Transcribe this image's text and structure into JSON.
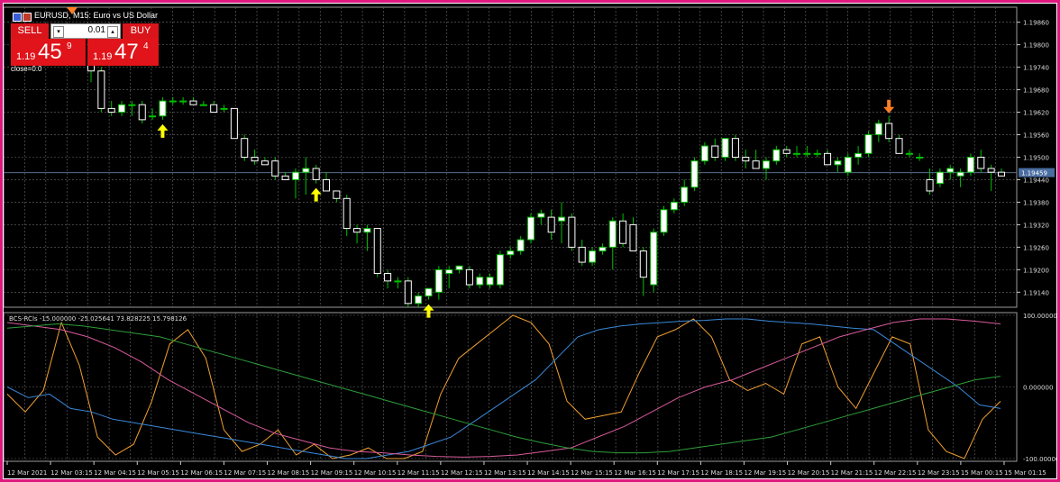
{
  "window": {
    "symbol_line": "EURUSD, M15:  Euro vs US Dollar",
    "close_label": "close=0.0"
  },
  "trade_panel": {
    "sell_label": "SELL",
    "buy_label": "BUY",
    "lot_value": "0.01",
    "sell_big_prefix": "1.19",
    "sell_big_digits": "45",
    "sell_sup": "9",
    "buy_big_prefix": "1.19",
    "buy_big_digits": "47",
    "buy_sup": "4"
  },
  "colors": {
    "background": "#000000",
    "grid": "#6b6b6b",
    "candle_bull": "#ffffff",
    "candle_bear": "#ffffff",
    "wick": "#00c000",
    "arrow_up": "#ffff00",
    "arrow_down": "#ff7f27",
    "rci_short": "#f0a030",
    "rci_mid": "#3a88d8",
    "rci_long": "#d85a9a",
    "rci_green": "#2e9e3a"
  },
  "chart_data": [
    {
      "type": "candlestick",
      "y_ticks": [
        "1.19860",
        "1.19800",
        "1.19740",
        "1.19680",
        "1.19620",
        "1.19560",
        "1.19500",
        "1.19440",
        "1.19380",
        "1.19320",
        "1.19260",
        "1.19200",
        "1.19140"
      ],
      "ylim": [
        1.191,
        1.199
      ],
      "current_price_label": "1.19459",
      "current_price": 1.19459,
      "candles": [
        {
          "o": 1.1977,
          "h": 1.198,
          "l": 1.197,
          "c": 1.1973
        },
        {
          "o": 1.1973,
          "h": 1.1974,
          "l": 1.1962,
          "c": 1.1963
        },
        {
          "o": 1.1963,
          "h": 1.1965,
          "l": 1.1961,
          "c": 1.1962
        },
        {
          "o": 1.1962,
          "h": 1.1965,
          "l": 1.1961,
          "c": 1.1964
        },
        {
          "o": 1.1964,
          "h": 1.1965,
          "l": 1.1961,
          "c": 1.1964
        },
        {
          "o": 1.1964,
          "h": 1.1965,
          "l": 1.1959,
          "c": 1.196
        },
        {
          "o": 1.1961,
          "h": 1.1963,
          "l": 1.196,
          "c": 1.1961
        },
        {
          "o": 1.1961,
          "h": 1.1966,
          "l": 1.196,
          "c": 1.1965
        },
        {
          "o": 1.1965,
          "h": 1.1966,
          "l": 1.1964,
          "c": 1.1965
        },
        {
          "o": 1.1965,
          "h": 1.1966,
          "l": 1.1964,
          "c": 1.1965
        },
        {
          "o": 1.1965,
          "h": 1.1966,
          "l": 1.1964,
          "c": 1.1964
        },
        {
          "o": 1.1964,
          "h": 1.1965,
          "l": 1.1964,
          "c": 1.1964
        },
        {
          "o": 1.1964,
          "h": 1.1965,
          "l": 1.1962,
          "c": 1.1962
        },
        {
          "o": 1.1963,
          "h": 1.1964,
          "l": 1.1962,
          "c": 1.1963
        },
        {
          "o": 1.1963,
          "h": 1.1963,
          "l": 1.1955,
          "c": 1.1955
        },
        {
          "o": 1.1955,
          "h": 1.1956,
          "l": 1.1949,
          "c": 1.195
        },
        {
          "o": 1.195,
          "h": 1.1952,
          "l": 1.1948,
          "c": 1.1949
        },
        {
          "o": 1.1949,
          "h": 1.195,
          "l": 1.1948,
          "c": 1.1948
        },
        {
          "o": 1.1949,
          "h": 1.195,
          "l": 1.1944,
          "c": 1.1945
        },
        {
          "o": 1.1945,
          "h": 1.1946,
          "l": 1.1944,
          "c": 1.1944
        },
        {
          "o": 1.1944,
          "h": 1.1947,
          "l": 1.1939,
          "c": 1.1946
        },
        {
          "o": 1.1946,
          "h": 1.195,
          "l": 1.194,
          "c": 1.1947
        },
        {
          "o": 1.1947,
          "h": 1.1948,
          "l": 1.1943,
          "c": 1.1944
        },
        {
          "o": 1.1944,
          "h": 1.1946,
          "l": 1.1941,
          "c": 1.1941
        },
        {
          "o": 1.1941,
          "h": 1.1941,
          "l": 1.1938,
          "c": 1.1939
        },
        {
          "o": 1.1939,
          "h": 1.194,
          "l": 1.1929,
          "c": 1.1931
        },
        {
          "o": 1.1931,
          "h": 1.1932,
          "l": 1.1927,
          "c": 1.193
        },
        {
          "o": 1.193,
          "h": 1.1932,
          "l": 1.1925,
          "c": 1.1931
        },
        {
          "o": 1.1931,
          "h": 1.1931,
          "l": 1.1918,
          "c": 1.1919
        },
        {
          "o": 1.1919,
          "h": 1.192,
          "l": 1.1915,
          "c": 1.1917
        },
        {
          "o": 1.1917,
          "h": 1.1918,
          "l": 1.1915,
          "c": 1.1917
        },
        {
          "o": 1.1917,
          "h": 1.1918,
          "l": 1.191,
          "c": 1.1911
        },
        {
          "o": 1.1911,
          "h": 1.1914,
          "l": 1.191,
          "c": 1.1913
        },
        {
          "o": 1.1913,
          "h": 1.1915,
          "l": 1.1912,
          "c": 1.1915
        },
        {
          "o": 1.1914,
          "h": 1.1921,
          "l": 1.1912,
          "c": 1.192
        },
        {
          "o": 1.1919,
          "h": 1.1921,
          "l": 1.1915,
          "c": 1.192
        },
        {
          "o": 1.192,
          "h": 1.1921,
          "l": 1.1919,
          "c": 1.1921
        },
        {
          "o": 1.192,
          "h": 1.1921,
          "l": 1.1915,
          "c": 1.1916
        },
        {
          "o": 1.1916,
          "h": 1.1919,
          "l": 1.1915,
          "c": 1.1918
        },
        {
          "o": 1.1916,
          "h": 1.1919,
          "l": 1.1915,
          "c": 1.1918
        },
        {
          "o": 1.1916,
          "h": 1.1925,
          "l": 1.1915,
          "c": 1.1924
        },
        {
          "o": 1.1924,
          "h": 1.1926,
          "l": 1.1923,
          "c": 1.1925
        },
        {
          "o": 1.1925,
          "h": 1.1929,
          "l": 1.1924,
          "c": 1.1928
        },
        {
          "o": 1.1928,
          "h": 1.1935,
          "l": 1.1927,
          "c": 1.1934
        },
        {
          "o": 1.1934,
          "h": 1.1936,
          "l": 1.1932,
          "c": 1.1935
        },
        {
          "o": 1.1934,
          "h": 1.1936,
          "l": 1.1928,
          "c": 1.193
        },
        {
          "o": 1.1933,
          "h": 1.1938,
          "l": 1.1927,
          "c": 1.1934
        },
        {
          "o": 1.1934,
          "h": 1.1935,
          "l": 1.1925,
          "c": 1.1926
        },
        {
          "o": 1.1926,
          "h": 1.1928,
          "l": 1.1921,
          "c": 1.1922
        },
        {
          "o": 1.1922,
          "h": 1.1926,
          "l": 1.1921,
          "c": 1.1925
        },
        {
          "o": 1.1925,
          "h": 1.1927,
          "l": 1.1924,
          "c": 1.1926
        },
        {
          "o": 1.1926,
          "h": 1.1934,
          "l": 1.192,
          "c": 1.1933
        },
        {
          "o": 1.1933,
          "h": 1.1935,
          "l": 1.1926,
          "c": 1.1927
        },
        {
          "o": 1.1932,
          "h": 1.1934,
          "l": 1.1925,
          "c": 1.1925
        },
        {
          "o": 1.1925,
          "h": 1.1926,
          "l": 1.1913,
          "c": 1.1918
        },
        {
          "o": 1.1916,
          "h": 1.1931,
          "l": 1.1914,
          "c": 1.193
        },
        {
          "o": 1.193,
          "h": 1.1937,
          "l": 1.1929,
          "c": 1.1936
        },
        {
          "o": 1.1936,
          "h": 1.1939,
          "l": 1.1935,
          "c": 1.1938
        },
        {
          "o": 1.1938,
          "h": 1.1944,
          "l": 1.1937,
          "c": 1.1942
        },
        {
          "o": 1.1942,
          "h": 1.195,
          "l": 1.1941,
          "c": 1.1949
        },
        {
          "o": 1.1949,
          "h": 1.1954,
          "l": 1.1948,
          "c": 1.1953
        },
        {
          "o": 1.1953,
          "h": 1.1955,
          "l": 1.1949,
          "c": 1.195
        },
        {
          "o": 1.195,
          "h": 1.1955,
          "l": 1.1949,
          "c": 1.1955
        },
        {
          "o": 1.1955,
          "h": 1.1956,
          "l": 1.1949,
          "c": 1.195
        },
        {
          "o": 1.195,
          "h": 1.1952,
          "l": 1.1947,
          "c": 1.1949
        },
        {
          "o": 1.1949,
          "h": 1.1952,
          "l": 1.1947,
          "c": 1.1947
        },
        {
          "o": 1.1947,
          "h": 1.195,
          "l": 1.1944,
          "c": 1.1949
        },
        {
          "o": 1.1949,
          "h": 1.1953,
          "l": 1.1948,
          "c": 1.1952
        },
        {
          "o": 1.1952,
          "h": 1.1953,
          "l": 1.195,
          "c": 1.1951
        },
        {
          "o": 1.1951,
          "h": 1.1953,
          "l": 1.195,
          "c": 1.1951
        },
        {
          "o": 1.1951,
          "h": 1.1953,
          "l": 1.195,
          "c": 1.1951
        },
        {
          "o": 1.1951,
          "h": 1.1952,
          "l": 1.195,
          "c": 1.1951
        },
        {
          "o": 1.1951,
          "h": 1.1952,
          "l": 1.1948,
          "c": 1.1948
        },
        {
          "o": 1.1948,
          "h": 1.195,
          "l": 1.1946,
          "c": 1.1949
        },
        {
          "o": 1.1946,
          "h": 1.1951,
          "l": 1.1945,
          "c": 1.195
        },
        {
          "o": 1.195,
          "h": 1.1953,
          "l": 1.1948,
          "c": 1.1951
        },
        {
          "o": 1.1951,
          "h": 1.1957,
          "l": 1.195,
          "c": 1.1956
        },
        {
          "o": 1.1956,
          "h": 1.196,
          "l": 1.1954,
          "c": 1.1959
        },
        {
          "o": 1.1959,
          "h": 1.1961,
          "l": 1.1954,
          "c": 1.1955
        },
        {
          "o": 1.1955,
          "h": 1.1956,
          "l": 1.1951,
          "c": 1.1951
        },
        {
          "o": 1.1951,
          "h": 1.1952,
          "l": 1.195,
          "c": 1.1951
        },
        {
          "o": 1.195,
          "h": 1.1951,
          "l": 1.1949,
          "c": 1.195
        },
        {
          "o": 1.1944,
          "h": 1.1947,
          "l": 1.194,
          "c": 1.1941
        },
        {
          "o": 1.1943,
          "h": 1.1947,
          "l": 1.1942,
          "c": 1.1946
        },
        {
          "o": 1.1946,
          "h": 1.1948,
          "l": 1.1944,
          "c": 1.1947
        },
        {
          "o": 1.1945,
          "h": 1.1947,
          "l": 1.1942,
          "c": 1.1946
        },
        {
          "o": 1.1946,
          "h": 1.1951,
          "l": 1.1945,
          "c": 1.195
        },
        {
          "o": 1.195,
          "h": 1.1952,
          "l": 1.1946,
          "c": 1.1947
        },
        {
          "o": 1.1947,
          "h": 1.1948,
          "l": 1.1941,
          "c": 1.1946
        },
        {
          "o": 1.1946,
          "h": 1.1947,
          "l": 1.1945,
          "c": 1.1945
        }
      ],
      "arrows_up_at": [
        7,
        22,
        33
      ],
      "arrows_down_at": [
        78
      ]
    },
    {
      "type": "line",
      "indicator_label": "BCS-RCIs -15.000000 -25.025641 73.828225 15.798126",
      "y_tick_labels": [
        "100.000000",
        "0.000000",
        "-100.000000"
      ],
      "ylim": [
        -100,
        100
      ],
      "x_labels": [
        "12 Mar 2021",
        "12 Mar 03:15",
        "12 Mar 04:15",
        "12 Mar 05:15",
        "12 Mar 06:15",
        "12 Mar 07:15",
        "12 Mar 08:15",
        "12 Mar 09:15",
        "12 Mar 10:15",
        "12 Mar 11:15",
        "12 Mar 12:15",
        "12 Mar 13:15",
        "12 Mar 14:15",
        "12 Mar 15:15",
        "12 Mar 16:15",
        "12 Mar 17:15",
        "12 Mar 18:15",
        "12 Mar 19:15",
        "12 Mar 20:15",
        "12 Mar 21:15",
        "12 Mar 22:15",
        "12 Mar 23:15",
        "15 Mar 00:15",
        "15 Mar 01:15"
      ],
      "series": [
        {
          "key": "rci_short",
          "values": [
            -10,
            -35,
            -5,
            90,
            30,
            -70,
            -95,
            -80,
            -20,
            60,
            80,
            40,
            -60,
            -90,
            -80,
            -60,
            -95,
            -80,
            -100,
            -95,
            -85,
            -100,
            -100,
            -90,
            -10,
            40,
            60,
            80,
            100,
            90,
            60,
            -20,
            -45,
            -40,
            -35,
            20,
            70,
            80,
            95,
            70,
            10,
            -5,
            5,
            -10,
            60,
            70,
            0,
            -30,
            20,
            70,
            60,
            -60,
            -90,
            -100,
            -45,
            -20
          ]
        },
        {
          "key": "rci_mid",
          "values": [
            0,
            -15,
            -10,
            -30,
            -35,
            -45,
            -50,
            -55,
            -60,
            -65,
            -70,
            -75,
            -80,
            -85,
            -90,
            -95,
            -100,
            -100,
            -95,
            -90,
            -80,
            -70,
            -50,
            -30,
            -10,
            10,
            40,
            70,
            80,
            85,
            88,
            90,
            92,
            93,
            95,
            95,
            92,
            90,
            88,
            85,
            82,
            80,
            60,
            40,
            20,
            0,
            -25,
            -30
          ]
        },
        {
          "key": "rci_long",
          "values": [
            90,
            85,
            80,
            70,
            55,
            35,
            10,
            -10,
            -30,
            -50,
            -65,
            -75,
            -85,
            -90,
            -92,
            -95,
            -97,
            -98,
            -97,
            -95,
            -90,
            -85,
            -70,
            -55,
            -35,
            -15,
            0,
            10,
            25,
            40,
            55,
            70,
            80,
            90,
            95,
            95,
            92,
            88
          ]
        },
        {
          "key": "rci_green",
          "values": [
            82,
            85,
            88,
            85,
            80,
            75,
            70,
            60,
            50,
            40,
            30,
            20,
            10,
            0,
            -10,
            -20,
            -30,
            -40,
            -50,
            -60,
            -70,
            -78,
            -85,
            -90,
            -92,
            -92,
            -90,
            -85,
            -80,
            -75,
            -70,
            -60,
            -50,
            -40,
            -30,
            -20,
            -10,
            0,
            10,
            15
          ]
        }
      ]
    }
  ]
}
